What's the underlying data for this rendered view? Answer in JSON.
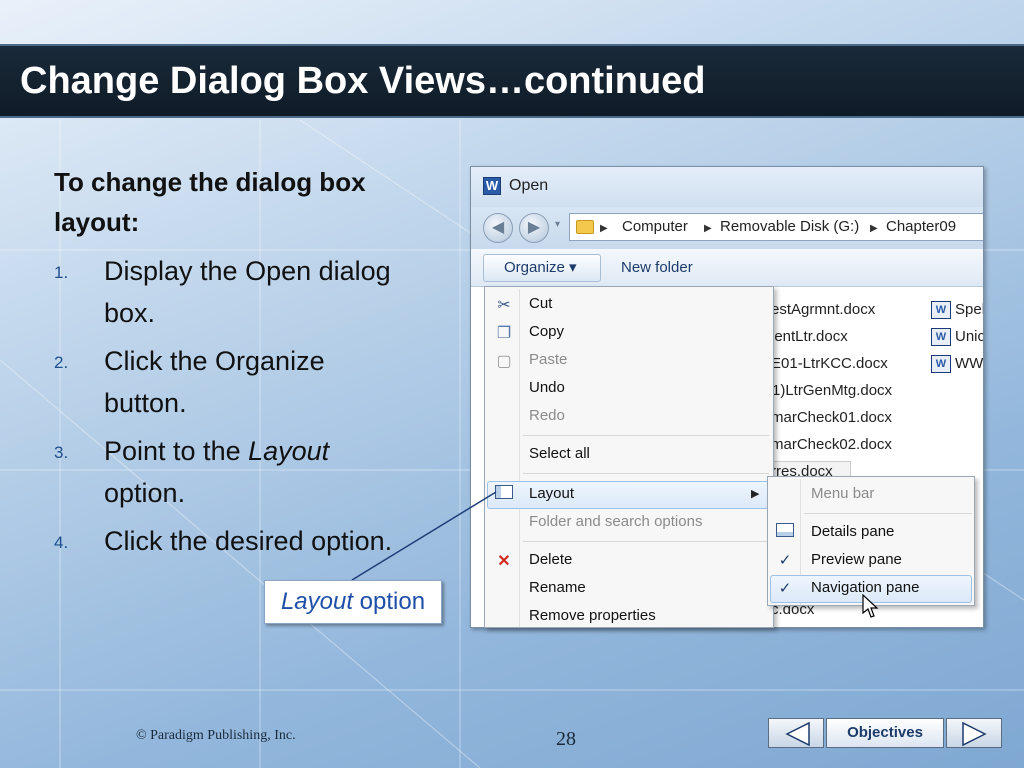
{
  "slide": {
    "title": "Change Dialog Box Views…continued",
    "instruction_heading": "To change the dialog box layout:",
    "steps": [
      {
        "num": "1.",
        "text": "Display the Open dialog box."
      },
      {
        "num": "2.",
        "text": "Click the Organize button."
      },
      {
        "num": "3.",
        "text_before": "Point to the ",
        "emph": "Layout",
        "text_after": " option."
      },
      {
        "num": "4.",
        "text": "Click the desired option."
      }
    ],
    "callout": {
      "emph": "Layout",
      "rest": " option"
    },
    "footer": {
      "copyright": "© Paradigm Publishing, Inc.",
      "page_number": "28"
    },
    "nav": {
      "prev_icon": "left-arrow-icon",
      "objectives_label": "Objectives",
      "next_icon": "right-arrow-icon"
    }
  },
  "dialog": {
    "title": "Open",
    "app_icon_letter": "W",
    "breadcrumbs": [
      "Computer",
      "Removable Disk (G:)",
      "Chapter09"
    ],
    "toolbar": {
      "organize_label": "Organize",
      "new_folder_label": "New folder"
    },
    "files_col1": [
      "estAgrmnt.docx",
      "ientLtr.docx",
      "E01-LtrKCC.docx",
      " (1)LtrGenMtg.docx",
      "marCheck01.docx",
      "marCheck02.docx",
      "rres.docx",
      "",
      "",
      "",
      "",
      "",
      "c.docx"
    ],
    "files_col2": [
      "Spel",
      "Unic",
      "WW"
    ]
  },
  "organize_menu": {
    "items": [
      {
        "label": "Cut",
        "icon": "scissors-icon",
        "disabled": false
      },
      {
        "label": "Copy",
        "icon": "copy-icon",
        "disabled": false
      },
      {
        "label": "Paste",
        "icon": "paste-icon",
        "disabled": true
      },
      {
        "label": "Undo",
        "icon": "",
        "disabled": false
      },
      {
        "label": "Redo",
        "icon": "",
        "disabled": true
      },
      {
        "label": "Select all",
        "icon": "",
        "disabled": false
      },
      {
        "label": "Layout",
        "icon": "layout-icon",
        "disabled": false
      },
      {
        "label": "Folder and search options",
        "icon": "",
        "disabled": true
      },
      {
        "label": "Delete",
        "icon": "delete-x-icon",
        "disabled": false
      },
      {
        "label": "Rename",
        "icon": "",
        "disabled": false
      },
      {
        "label": "Remove properties",
        "icon": "",
        "disabled": false
      }
    ]
  },
  "layout_submenu": {
    "items": [
      {
        "label": "Menu bar",
        "checked": false,
        "disabled": true
      },
      {
        "label": "Details pane",
        "checked": false,
        "disabled": false
      },
      {
        "label": "Preview pane",
        "checked": true,
        "disabled": false
      },
      {
        "label": "Navigation pane",
        "checked": true,
        "disabled": false
      }
    ]
  },
  "colors": {
    "title_bg": "#12202e",
    "accent_blue": "#1f4fa8",
    "number_blue": "#1f4e8c"
  }
}
